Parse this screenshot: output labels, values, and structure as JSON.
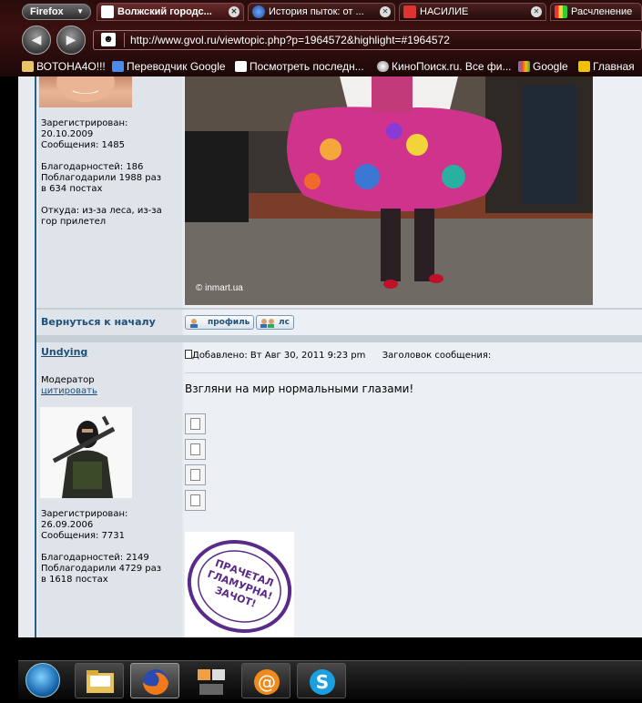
{
  "browser": {
    "menu_button": "Firefox",
    "tabs": [
      {
        "title": "Волжский городс...",
        "active": true
      },
      {
        "title": "История пыток: от ...",
        "active": false
      },
      {
        "title": "НАСИЛИЕ",
        "active": false
      },
      {
        "title": "Расчленение",
        "active": false
      }
    ],
    "url": "http://www.gvol.ru/viewtopic.php?p=1964572&highlight=#1964572",
    "bookmarks": [
      {
        "label": "ВОТОНА4О!!!"
      },
      {
        "label": "Переводчик Google"
      },
      {
        "label": "Посмотреть последн..."
      },
      {
        "label": "КиноПоиск.ru. Все фи..."
      },
      {
        "label": "Google"
      },
      {
        "label": "Главная"
      }
    ]
  },
  "post1": {
    "registered_label": "Зарегистрирован:",
    "registered_date": "20.10.2009",
    "messages": "Сообщения: 1485",
    "thanks": "Благодарностей: 186",
    "thanked": "Поблагодарили 1988 раз",
    "thanked_posts": "в 634 постах",
    "from_line1": "Откуда: из-за леса, из-за",
    "from_line2": "гор прилетел",
    "photo_watermark": "© inmart.ua",
    "back_to_top": "Вернуться к началу",
    "profile_btn": "профиль",
    "pm_btn": "лс"
  },
  "post2": {
    "username": "Undying",
    "rank": "Модератор",
    "quote_link": "цитировать",
    "registered_label": "Зарегистрирован:",
    "registered_date": "26.09.2006",
    "messages": "Сообщения: 7731",
    "thanks": "Благодарностей: 2149",
    "thanked": "Поблагодарили 4729 раз",
    "thanked_posts": "в 1618 постах",
    "added": "Добавлено: Вт Авг 30, 2011 9:23 pm",
    "subject_label": "Заголовок сообщения:",
    "text": "Взгляни на мир нормальными глазами!",
    "stamp_text": [
      "ПРАЧЕТАЛ",
      "ГЛАМУРНА!",
      "ЗАЧОТ!"
    ]
  },
  "colors": {
    "link": "#1e4f78",
    "stamp": "#5a2a8a",
    "chrome": "#2a0c0c"
  }
}
